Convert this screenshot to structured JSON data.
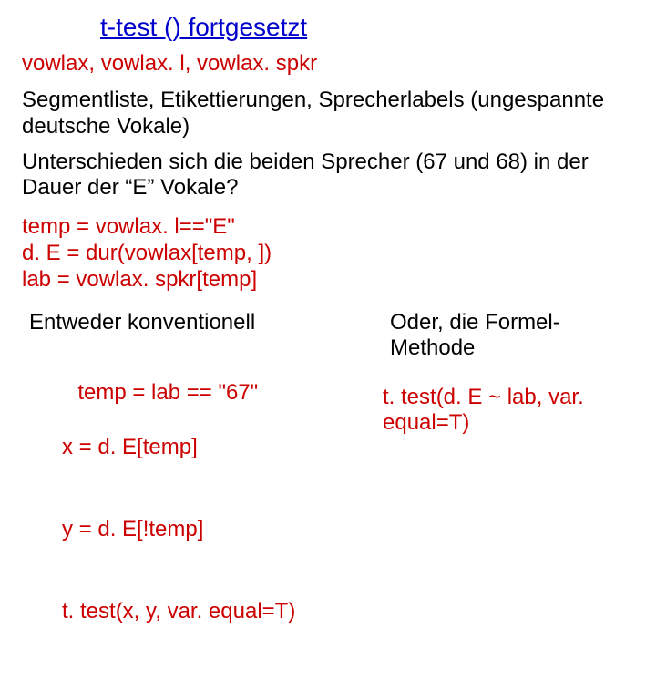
{
  "title": "t-test () fortgesetzt",
  "variables": "vowlax, vowlax. l, vowlax. spkr",
  "description": "Segmentliste, Etikettierungen, Sprecherlabels (ungespannte deutsche Vokale)",
  "question": "Unterschieden sich die beiden Sprecher (67 und 68) in der Dauer der “E” Vokale?",
  "setup_code": "temp = vowlax. l==\"E\"\nd. E = dur(vowlax[temp, ])\nlab = vowlax. spkr[temp]",
  "left": {
    "heading": "Entweder konventionell",
    "code_l1": "temp = lab == \"67\"",
    "code_l2": "x = d. E[temp]",
    "code_l3": "y = d. E[!temp]",
    "code_l4": "t. test(x, y, var. equal=T)"
  },
  "right": {
    "heading": "Oder, die Formel-Methode",
    "code": "t. test(d. E ~ lab, var. equal=T)"
  }
}
